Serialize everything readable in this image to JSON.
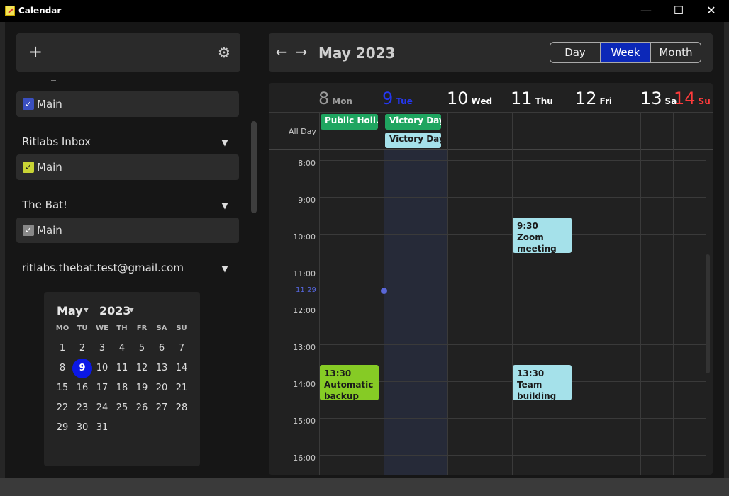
{
  "window": {
    "title": "Calendar",
    "minimize": "—",
    "maximize": "☐",
    "close": "✕"
  },
  "sidebar": {
    "add_label": "+",
    "accounts": [
      {
        "name": "",
        "calendar": "Main",
        "color": "#3a4fc0"
      },
      {
        "name": "Ritlabs Inbox",
        "calendar": "Main",
        "color": "#c9d435"
      },
      {
        "name": "The Bat!",
        "calendar": "Main",
        "color": "#888888"
      },
      {
        "name": "ritlabs.thebat.test@gmail.com"
      }
    ]
  },
  "mini_calendar": {
    "month": "May",
    "year": "2023",
    "weekdays": [
      "MO",
      "TU",
      "WE",
      "TH",
      "FR",
      "SA",
      "SU"
    ],
    "weeks": [
      [
        "1",
        "2",
        "3",
        "4",
        "5",
        "6",
        "7"
      ],
      [
        "8",
        "9",
        "10",
        "11",
        "12",
        "13",
        "14"
      ],
      [
        "15",
        "16",
        "17",
        "18",
        "19",
        "20",
        "21"
      ],
      [
        "22",
        "23",
        "24",
        "25",
        "26",
        "27",
        "28"
      ],
      [
        "29",
        "30",
        "31",
        "",
        "",
        "",
        ""
      ]
    ],
    "today": "9"
  },
  "toolbar": {
    "prev": "←",
    "next": "→",
    "title": "May 2023",
    "views": [
      "Day",
      "Week",
      "Month"
    ],
    "active_view": "Week"
  },
  "week": {
    "days": [
      {
        "num": "8",
        "name": "Mon",
        "color": "#9a9a9a"
      },
      {
        "num": "9",
        "name": "Tue",
        "color": "#2437f0"
      },
      {
        "num": "10",
        "name": "Wed",
        "color": "#ffffff"
      },
      {
        "num": "11",
        "name": "Thu",
        "color": "#ffffff"
      },
      {
        "num": "12",
        "name": "Fri",
        "color": "#ffffff"
      },
      {
        "num": "13",
        "name": "Sa",
        "color": "#ffffff"
      },
      {
        "num": "14",
        "name": "Su",
        "color": "#ff3b3b"
      }
    ],
    "all_day_label": "All Day",
    "times": [
      "8:00",
      "9:00",
      "10:00",
      "11:00",
      "12:00",
      "13:00",
      "14:00",
      "15:00",
      "16:00"
    ],
    "now": "11:29",
    "all_day_events": [
      {
        "title": "Public Holi...",
        "day": "Mon",
        "color": "#1fa560"
      },
      {
        "title": "Victory Day",
        "day": "Tue",
        "color": "#1fa560"
      },
      {
        "title": "Victory Day",
        "day": "Tue",
        "color": "#a5e1ea"
      }
    ],
    "events": [
      {
        "time": "9:30",
        "title": "Zoom meeting",
        "day": "Thu",
        "color": "#a5e1ea"
      },
      {
        "time": "13:30",
        "title": "Automatic backup",
        "day": "Mon",
        "color": "#86cb25"
      },
      {
        "time": "13:30",
        "title": "Team building",
        "day": "Thu",
        "color": "#a5e1ea"
      }
    ]
  }
}
